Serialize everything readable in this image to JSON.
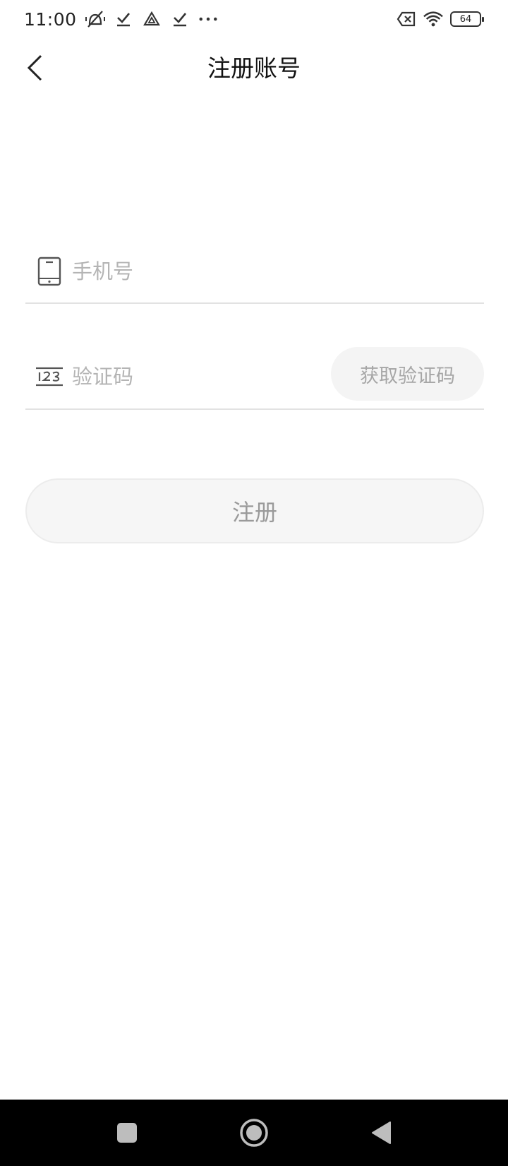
{
  "status_bar": {
    "time": "11:00",
    "icons_left": [
      "mute-vibrate-icon",
      "download-done-icon",
      "drive-icon",
      "download-done-icon",
      "more-dots-icon"
    ],
    "icons_right": [
      "no-sim-icon",
      "wifi-icon",
      "battery-icon"
    ],
    "battery_level": "64"
  },
  "header": {
    "title": "注册账号",
    "back_icon": "chevron-left-icon"
  },
  "form": {
    "phone": {
      "placeholder": "手机号",
      "value": "",
      "icon": "phone-icon"
    },
    "code": {
      "placeholder": "验证码",
      "value": "",
      "icon": "number-123-icon"
    },
    "get_code_label": "获取验证码",
    "register_label": "注册"
  },
  "nav_bar": {
    "buttons": [
      "recent-apps-icon",
      "home-icon",
      "back-triangle-icon"
    ]
  },
  "colors": {
    "background": "#ffffff",
    "button_bg": "#f4f4f4",
    "disabled_text": "#a6a6a6",
    "divider": "#e2e2e2",
    "nav_bar": "#000000"
  }
}
